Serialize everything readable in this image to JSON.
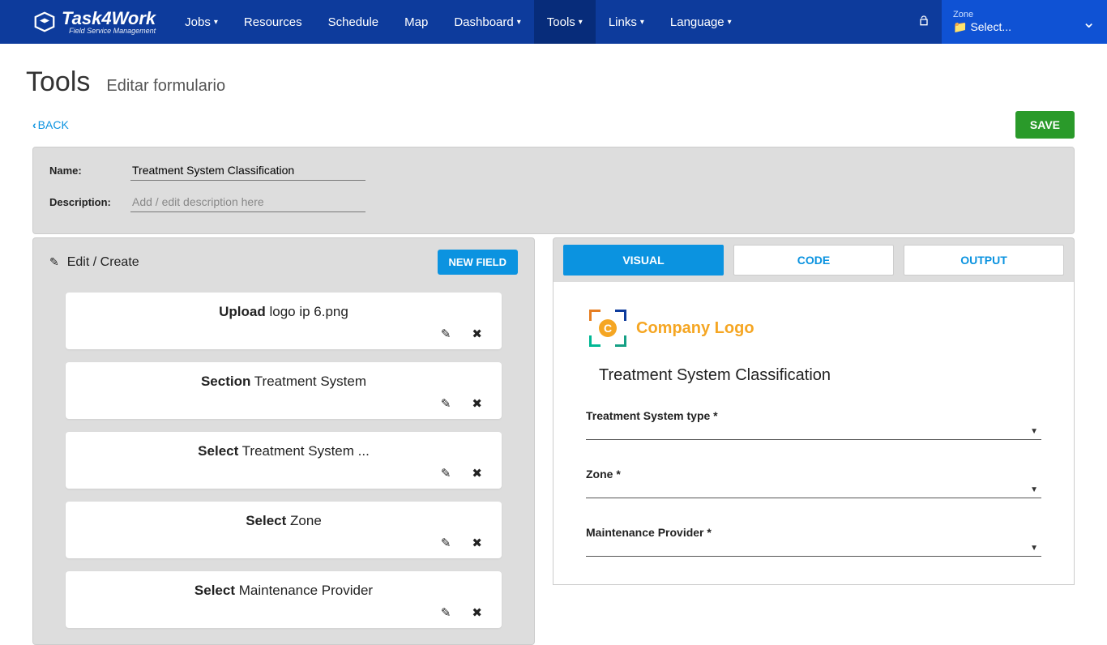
{
  "nav": {
    "brand_main": "Task4Work",
    "brand_sub": "Field Service Management",
    "items": [
      {
        "label": "Jobs",
        "caret": true
      },
      {
        "label": "Resources",
        "caret": false
      },
      {
        "label": "Schedule",
        "caret": false
      },
      {
        "label": "Map",
        "caret": false
      },
      {
        "label": "Dashboard",
        "caret": true
      },
      {
        "label": "Tools",
        "caret": true,
        "active": true
      },
      {
        "label": "Links",
        "caret": true
      },
      {
        "label": "Language",
        "caret": true
      }
    ],
    "zone_label": "Zone",
    "zone_value": "Select..."
  },
  "header": {
    "title": "Tools",
    "subtitle": "Editar formulario"
  },
  "actions": {
    "back": "BACK",
    "save": "SAVE"
  },
  "info": {
    "name_label": "Name:",
    "name_value": "Treatment System Classification",
    "desc_label": "Description:",
    "desc_placeholder": "Add / edit description here"
  },
  "left": {
    "header": "Edit / Create",
    "newfield": "NEW FIELD",
    "cards": [
      {
        "type": "Upload",
        "name": "logo ip 6.png"
      },
      {
        "type": "Section",
        "name": "Treatment System"
      },
      {
        "type": "Select",
        "name": "Treatment System ..."
      },
      {
        "type": "Select",
        "name": "Zone"
      },
      {
        "type": "Select",
        "name": "Maintenance Provider"
      }
    ]
  },
  "right": {
    "tabs": {
      "visual": "VISUAL",
      "code": "CODE",
      "output": "OUTPUT"
    },
    "company_logo": "Company Logo",
    "logo_letter": "C",
    "form_title": "Treatment System Classification",
    "fields": [
      {
        "label": "Treatment System type *"
      },
      {
        "label": "Zone *"
      },
      {
        "label": "Maintenance Provider *"
      }
    ]
  }
}
